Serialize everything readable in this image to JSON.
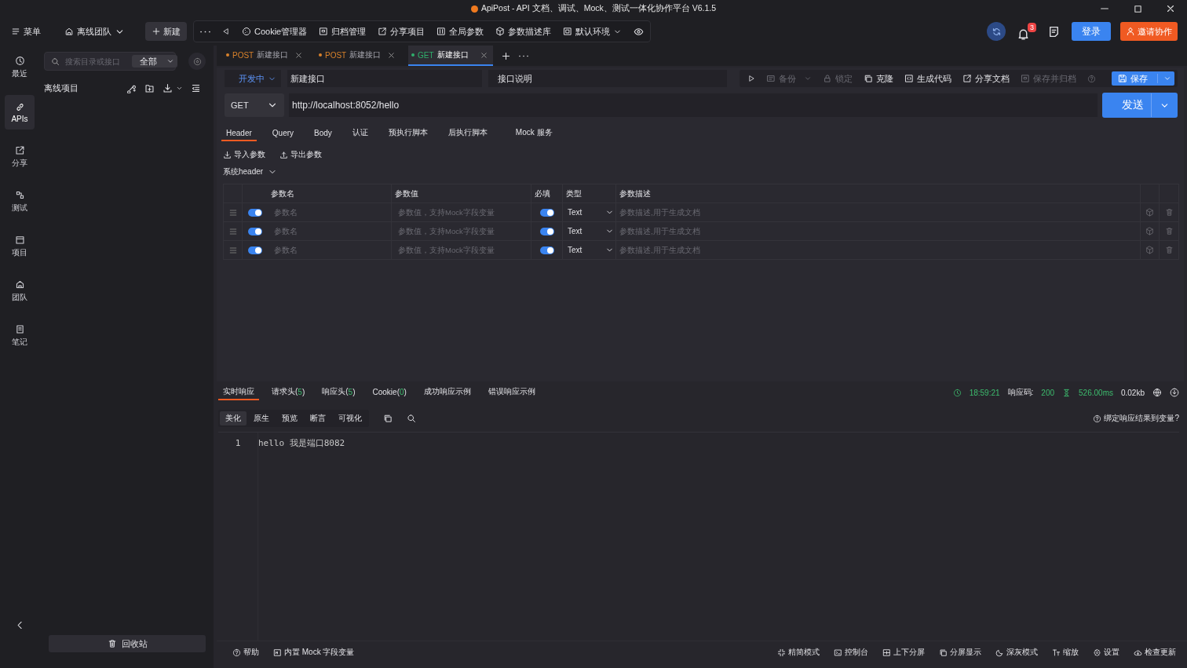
{
  "window": {
    "title": "ApiPost - API 文档、调试、Mock、测试一体化协作平台 V6.1.5"
  },
  "toolbar": {
    "menu": "菜单",
    "team": "离线团队",
    "new_button": "新建",
    "items": [
      {
        "label": "Cookie管理器"
      },
      {
        "label": "归档管理"
      },
      {
        "label": "分享项目"
      },
      {
        "label": "全局参数"
      },
      {
        "label": "参数描述库"
      }
    ],
    "environment": "默认环境",
    "notifications": "3",
    "login": "登录",
    "invite": "邀请协作"
  },
  "nav": [
    {
      "label": "最近",
      "selected": false
    },
    {
      "label": "APIs",
      "selected": true
    },
    {
      "label": "分享",
      "selected": false
    },
    {
      "label": "测试",
      "selected": false
    },
    {
      "label": "项目",
      "selected": false
    },
    {
      "label": "团队",
      "selected": false
    },
    {
      "label": "笔记",
      "selected": false
    }
  ],
  "sidebar": {
    "search_placeholder": "搜索目录或接口",
    "filter": "全部",
    "project": "离线项目",
    "trash": "回收站"
  },
  "tabs": [
    {
      "method": "POST",
      "name": "新建接口",
      "selected": false
    },
    {
      "method": "POST",
      "name": "新建接口",
      "selected": false
    },
    {
      "method": "GET",
      "name": "新建接口",
      "selected": true
    }
  ],
  "request": {
    "status": "开发中",
    "name": "新建接口",
    "description_label": "接口说明",
    "actions": [
      {
        "label": "备份",
        "disabled": true,
        "dropdown": true
      },
      {
        "label": "锁定",
        "disabled": true,
        "dropdown": false
      },
      {
        "label": "克隆",
        "disabled": false,
        "dropdown": false
      },
      {
        "label": "生成代码",
        "disabled": false,
        "dropdown": false
      },
      {
        "label": "分享文档",
        "disabled": false,
        "dropdown": false
      },
      {
        "label": "保存并归档",
        "disabled": true,
        "dropdown": false
      }
    ],
    "save": "保存",
    "method": "GET",
    "url": "http://localhost:8052/hello",
    "send": "发送"
  },
  "request_tabs": [
    {
      "label": "Header",
      "selected": true
    },
    {
      "label": "Query",
      "selected": false
    },
    {
      "label": "Body",
      "selected": false
    },
    {
      "label": "认证",
      "selected": false
    },
    {
      "label": "预执行脚本",
      "selected": false
    },
    {
      "label": "后执行脚本",
      "selected": false
    },
    {
      "label": "Mock 服务",
      "selected": false
    }
  ],
  "param_actions": [
    {
      "label": "导入参数"
    },
    {
      "label": "导出参数"
    }
  ],
  "system_header": "系统header",
  "params_table": {
    "columns": [
      "参数名",
      "参数值",
      "必填",
      "类型",
      "参数描述"
    ],
    "rows": [
      {
        "enabled": true,
        "name_placeholder": "参数名",
        "value_placeholder": "参数值，支持Mock字段变量",
        "required": true,
        "type": "Text",
        "description_placeholder": "参数描述,用于生成文档"
      },
      {
        "enabled": true,
        "name_placeholder": "参数名",
        "value_placeholder": "参数值，支持Mock字段变量",
        "required": true,
        "type": "Text",
        "description_placeholder": "参数描述,用于生成文档"
      },
      {
        "enabled": true,
        "name_placeholder": "参数名",
        "value_placeholder": "参数值，支持Mock字段变量",
        "required": true,
        "type": "Text",
        "description_placeholder": "参数描述,用于生成文档"
      }
    ]
  },
  "response_tabs": [
    {
      "label": "实时响应",
      "selected": true
    },
    {
      "label": "请求头(",
      "count": "5",
      "suffix": ")",
      "selected": false
    },
    {
      "label": "响应头(",
      "count": "5",
      "suffix": ")",
      "selected": false
    },
    {
      "label": "Cookie(",
      "count": "0",
      "suffix": ")",
      "selected": false
    },
    {
      "label": "成功响应示例",
      "selected": false
    },
    {
      "label": "错误响应示例",
      "selected": false
    }
  ],
  "response_status": {
    "time": "18:59:21",
    "code_label": "响应码:",
    "code": "200",
    "duration": "526.00ms",
    "size": "0.02kb"
  },
  "view_tabs": [
    {
      "label": "美化",
      "selected": true
    },
    {
      "label": "原生",
      "selected": false
    },
    {
      "label": "预览",
      "selected": false
    },
    {
      "label": "断言",
      "selected": false
    },
    {
      "label": "可视化",
      "selected": false
    }
  ],
  "bind_hint": "绑定响应结果到变量?",
  "response_body": {
    "lines": [
      {
        "number": "1",
        "text": "hello 我是端口8082"
      }
    ]
  },
  "footer": {
    "left": [
      {
        "label": "帮助"
      },
      {
        "label": "内置 Mock 字段变量"
      }
    ],
    "right": [
      {
        "label": "精简模式"
      },
      {
        "label": "控制台"
      },
      {
        "label": "上下分屏"
      },
      {
        "label": "分屏显示"
      },
      {
        "label": "深灰模式"
      },
      {
        "label": "缩放"
      },
      {
        "label": "设置"
      },
      {
        "label": "检查更新"
      }
    ]
  }
}
